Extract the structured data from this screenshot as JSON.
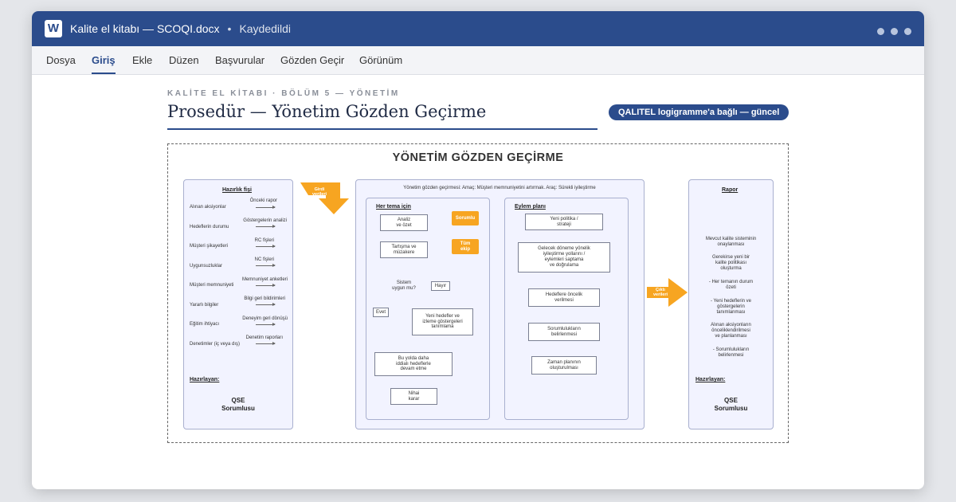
{
  "window": {
    "app_icon": "W",
    "file_title": "Kalite el kitabı — SCOQI.docx",
    "separator": "•",
    "save_status": "Kaydedildi"
  },
  "menu": [
    "Dosya",
    "Giriş",
    "Ekle",
    "Düzen",
    "Başvurular",
    "Gözden Geçir",
    "Görünüm"
  ],
  "menu_active": "Giriş",
  "document": {
    "eyebrow": "KALİTE EL KİTABI · BÖLÜM 5 — YÖNETİM",
    "title": "Prosedür — Yönetim Gözden Geçirme",
    "badge": "QALITEL logigramme'a bağlı — güncel"
  },
  "figure": {
    "title": "YÖNETİM GÖZDEN GEÇİRME",
    "left_panel": {
      "heading": "Hazırlık fişi",
      "rows": [
        {
          "item": "Alınan aksiyonlar",
          "source": "Önceki rapor"
        },
        {
          "item": "Hedeflerin durumu",
          "source": "Göstergelerin analizi"
        },
        {
          "item": "Müşteri şikayetleri",
          "source": "RC fişleri"
        },
        {
          "item": "Uygunsuzluklar",
          "source": "NC fişleri"
        },
        {
          "item": "Müşteri memnuniyeti",
          "source": "Memnuniyet anketleri"
        },
        {
          "item": "Yararlı bilgiler",
          "source": "Bilgi geri bildirimleri"
        },
        {
          "item": "Eğitim ihtiyacı",
          "source": "Deneyim geri dönüşü"
        },
        {
          "item": "Denetimler (iç veya dış)",
          "source": "Denetim raporları"
        }
      ],
      "prepared_label": "Hazırlayan:",
      "preparer_line1": "QSE",
      "preparer_line2": "Sorumlusu"
    },
    "input_arrow": {
      "line1": "Girdi",
      "line2": "verileri"
    },
    "center_panel": {
      "purpose": "Yönetim gözden geçirmesi: Amaç: Müşteri memnuniyetini artırmak. Araç: Sürekli iyileştirme",
      "left_sub": {
        "heading": "Her tema için",
        "analyze": {
          "line1": "Analiz",
          "line2": "ve özet"
        },
        "responsible": "Sorumlu",
        "discuss": {
          "line1": "Tartışma ve",
          "line2": "müzakere"
        },
        "whole_team": {
          "line1": "Tüm",
          "line2": "ekip"
        },
        "decision": {
          "line1": "Sistem",
          "line2": "uygun mu?"
        },
        "no": "Hayır",
        "yes": "Evet",
        "new_goals": {
          "line1": "Yeni hedefler ve",
          "line2": "izleme göstergeleri",
          "line3": "tanımlama"
        },
        "ambitious": {
          "line1": "Bu yolda daha",
          "line2": "iddialı hedeflerle",
          "line3": "devam etme"
        },
        "final": {
          "line1": "Nihai",
          "line2": "karar"
        }
      },
      "right_sub": {
        "heading": "Eylem planı",
        "policy": {
          "line1": "Yeni politika /",
          "line2": "strateji"
        },
        "improve": {
          "line1": "Gelecek döneme yönelik",
          "line2": "iyileştirme yollarını /",
          "line3": "eylemleri saptama",
          "line4": "ve doğrulama"
        },
        "priority": {
          "line1": "Hedeflere öncelik",
          "line2": "verilmesi"
        },
        "responsibilities": {
          "line1": "Sorumlulukların",
          "line2": "belirlenmesi"
        },
        "schedule": {
          "line1": "Zaman planının",
          "line2": "oluşturulması"
        }
      }
    },
    "output_arrow": {
      "line1": "Çıktı",
      "line2": "verileri"
    },
    "right_panel": {
      "heading": "Rapor",
      "items": [
        {
          "line1": "Mevcut kalite sisteminin",
          "line2": "onaylanması",
          "line3": ""
        },
        {
          "line1": "Gerekirse yeni bir",
          "line2": "kalite politikası",
          "line3": "oluşturma"
        },
        {
          "line1": "- Her temanın durum",
          "line2": "özeti",
          "line3": ""
        },
        {
          "line1": "- Yeni hedeflerin ve",
          "line2": "göstergelerin",
          "line3": "tanımlanması"
        },
        {
          "line1": "Alınan aksiyonların",
          "line2": "önceliklendirilmesi",
          "line3": "ve planlanması"
        },
        {
          "line1": "- Sorumlulukların",
          "line2": "belirlenmesi",
          "line3": ""
        }
      ],
      "prepared_label": "Hazırlayan:",
      "preparer_line1": "QSE",
      "preparer_line2": "Sorumlusu"
    }
  },
  "colors": {
    "titlebar": "#2b4c8c",
    "accent_orange": "#f7a521",
    "panel_fill": "#f2f3ff"
  }
}
